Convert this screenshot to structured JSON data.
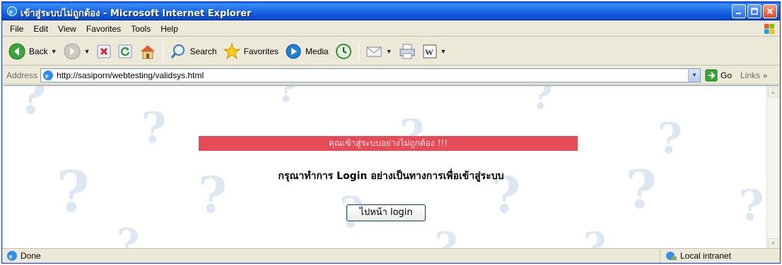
{
  "window": {
    "title": "เข้าสู่ระบบไม่ถูกต้อง - Microsoft Internet Explorer"
  },
  "menu": {
    "items": [
      {
        "label": "File"
      },
      {
        "label": "Edit"
      },
      {
        "label": "View"
      },
      {
        "label": "Favorites"
      },
      {
        "label": "Tools"
      },
      {
        "label": "Help"
      }
    ]
  },
  "toolbar": {
    "back_label": "Back",
    "search_label": "Search",
    "favorites_label": "Favorites",
    "media_label": "Media"
  },
  "address": {
    "label": "Address",
    "url": "http://sasiporn/webtesting/validsys.html",
    "go_label": "Go",
    "links_label": "Links"
  },
  "page": {
    "error_banner": "คุณเข้าสู่ระบบอย่างไม่ถูกต้อง !!!",
    "instruction": "กรุณาทำการ Login อย่างเป็นทางการเพื่อเข้าสู่ระบบ",
    "login_button": "ไปหน้า login",
    "background_glyph": "?"
  },
  "status": {
    "text": "Done",
    "zone": "Local intranet"
  },
  "colors": {
    "titlebar": "#0a5ae6",
    "banner": "#e64b58",
    "chrome": "#ece9d8"
  }
}
